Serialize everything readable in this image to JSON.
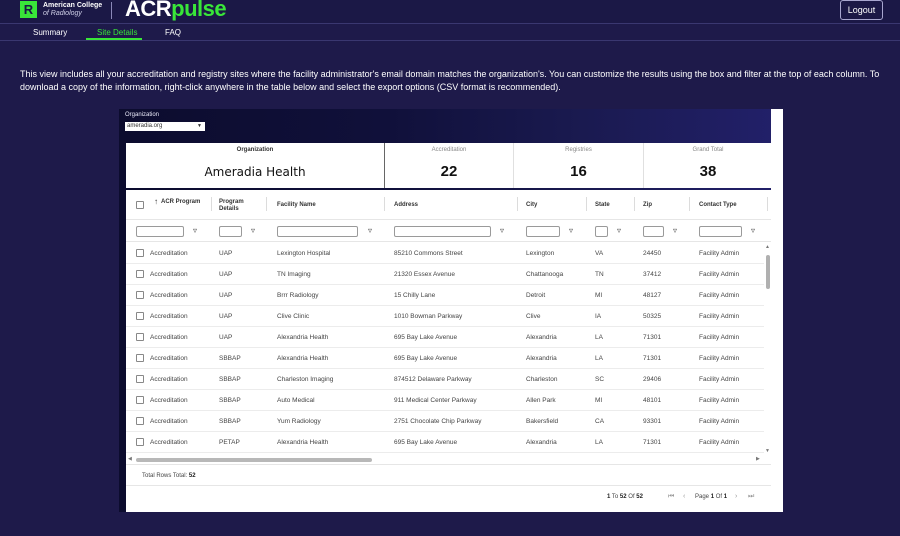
{
  "header": {
    "logo_letter": "R",
    "org_name_line1": "American College",
    "org_name_line2": "of Radiology",
    "brand_acr": "ACR",
    "brand_pulse": "pulse",
    "logout_label": "Logout"
  },
  "nav": {
    "tabs": [
      {
        "label": "Summary",
        "active": false
      },
      {
        "label": "Site Details",
        "active": true
      },
      {
        "label": "FAQ",
        "active": false
      }
    ]
  },
  "intro_text": "This view includes all your accreditation and registry sites where the facility administrator's email domain matches the organization's. You can customize the results using the box and filter at the top of each column. To download a copy of the information, right-click anywhere in the table below and select the export options (CSV format is recommended).",
  "report": {
    "org_filter_label": "Organization",
    "org_filter_value": "ameradia.org",
    "cards": {
      "organization_label": "Organization",
      "organization_value": "Ameradia Health",
      "accreditation_label": "Accreditation",
      "accreditation_value": "22",
      "registries_label": "Registries",
      "registries_value": "16",
      "grand_total_label": "Grand Total",
      "grand_total_value": "38"
    },
    "columns": {
      "acr_program": "ACR Program",
      "program_details": "Program Details",
      "facility_name": "Facility Name",
      "address": "Address",
      "city": "City",
      "state": "State",
      "zip": "Zip",
      "contact_type": "Contact Type"
    },
    "rows": [
      {
        "program": "Accreditation",
        "details": "UAP",
        "facility": "Lexington Hospital",
        "address": "85210 Commons Street",
        "city": "Lexington",
        "state": "VA",
        "zip": "24450",
        "contact": "Facility Admin"
      },
      {
        "program": "Accreditation",
        "details": "UAP",
        "facility": "TN Imaging",
        "address": "21320 Essex Avenue",
        "city": "Chattanooga",
        "state": "TN",
        "zip": "37412",
        "contact": "Facility Admin"
      },
      {
        "program": "Accreditation",
        "details": "UAP",
        "facility": "Brrr Radiology",
        "address": "15 Chilly Lane",
        "city": "Detroit",
        "state": "MI",
        "zip": "48127",
        "contact": "Facility Admin"
      },
      {
        "program": "Accreditation",
        "details": "UAP",
        "facility": "Clive Clinic",
        "address": "1010 Bowman Parkway",
        "city": "Clive",
        "state": "IA",
        "zip": "50325",
        "contact": "Facility Admin"
      },
      {
        "program": "Accreditation",
        "details": "UAP",
        "facility": "Alexandria Health",
        "address": "695 Bay Lake Avenue",
        "city": "Alexandria",
        "state": "LA",
        "zip": "71301",
        "contact": "Facility Admin"
      },
      {
        "program": "Accreditation",
        "details": "SBBAP",
        "facility": "Alexandria Health",
        "address": "695 Bay Lake Avenue",
        "city": "Alexandria",
        "state": "LA",
        "zip": "71301",
        "contact": "Facility Admin"
      },
      {
        "program": "Accreditation",
        "details": "SBBAP",
        "facility": "Charleston Imaging",
        "address": "874512 Delaware Parkway",
        "city": "Charleston",
        "state": "SC",
        "zip": "29406",
        "contact": "Facility Admin"
      },
      {
        "program": "Accreditation",
        "details": "SBBAP",
        "facility": "Auto Medical",
        "address": "911 Medical Center Parkway",
        "city": "Allen Park",
        "state": "MI",
        "zip": "48101",
        "contact": "Facility Admin"
      },
      {
        "program": "Accreditation",
        "details": "SBBAP",
        "facility": "Yum Radiology",
        "address": "2751 Chocolate Chip Parkway",
        "city": "Bakersfield",
        "state": "CA",
        "zip": "93301",
        "contact": "Facility Admin"
      },
      {
        "program": "Accreditation",
        "details": "PETAP",
        "facility": "Alexandria Health",
        "address": "695 Bay Lake Avenue",
        "city": "Alexandria",
        "state": "LA",
        "zip": "71301",
        "contact": "Facility Admin"
      }
    ],
    "footer": {
      "total_label": "Total Rows Total:",
      "total_value": "52",
      "range_start": "1",
      "range_to": "To",
      "range_end": "52",
      "range_of": "Of",
      "range_total": "52",
      "page_label": "Page",
      "page_current": "1",
      "page_of": "Of",
      "page_total": "1"
    },
    "icons": {
      "filter": "filter-icon",
      "sort": "sort-ascending-icon",
      "first": "first-page-icon",
      "prev": "previous-page-icon",
      "next": "next-page-icon",
      "last": "last-page-icon"
    }
  },
  "colors": {
    "background": "#1e1a4a",
    "accent": "#39e639"
  }
}
